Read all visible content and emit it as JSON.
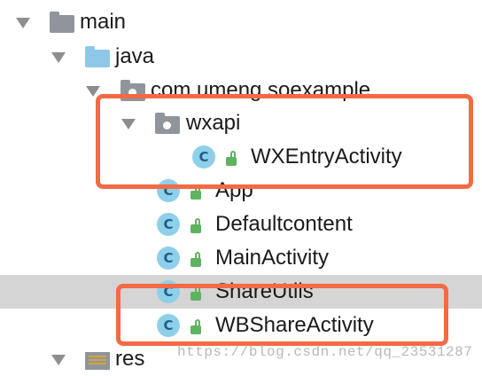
{
  "tree": {
    "main": "main",
    "java": "java",
    "package": "com.umeng.soexample",
    "wxapi": "wxapi",
    "wxentry": "WXEntryActivity",
    "app": "App",
    "defaultcontent": "Defaultcontent",
    "mainactivity": "MainActivity",
    "shareutils": "ShareUtils",
    "wbshare": "WBShareActivity",
    "res": "res"
  },
  "class_icon_letter": "C",
  "watermark": "https://blog.csdn.net/qq_23531287",
  "colors": {
    "highlight": "#f36a44",
    "selected_row": "#d5d5d5",
    "class_icon": "#8ed0ea",
    "folder_blue": "#8ec8e8",
    "lock_green": "#5fb35f"
  },
  "icons": [
    "folder-icon",
    "java-source-folder-icon",
    "package-icon",
    "class-icon",
    "lock-icon",
    "resource-folder-icon",
    "expand-arrow-icon"
  ]
}
